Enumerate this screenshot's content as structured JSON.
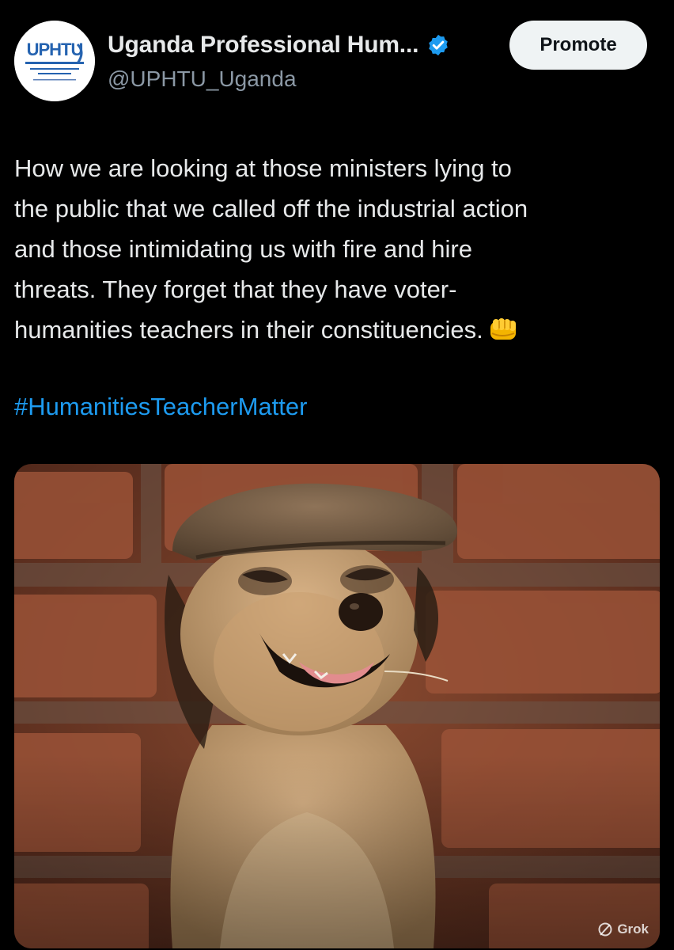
{
  "account": {
    "display_name": "Uganda Professional Hum...",
    "handle": "@UPHTU_Uganda",
    "logo_text": "UPHTU",
    "verified": true
  },
  "actions": {
    "promote_label": "Promote"
  },
  "tweet": {
    "lines": [
      "How we are looking at those ministers lying to",
      "the public that we called off the industrial action",
      "and those intimidating us with fire and hire",
      "threats.  They forget that they have voter-",
      "humanities teachers in their constituencies."
    ],
    "emoji": "oncoming-fist",
    "hashtag": "#HumanitiesTeacherMatter"
  },
  "media": {
    "watermark": "Grok",
    "subject": "meerkat-in-flat-cap"
  },
  "colors": {
    "background": "#000000",
    "text": "#e7e9ea",
    "secondary": "#8b98a5",
    "link": "#1d9bf0",
    "verified": "#1d9bf0",
    "button_bg": "#eff3f4"
  }
}
